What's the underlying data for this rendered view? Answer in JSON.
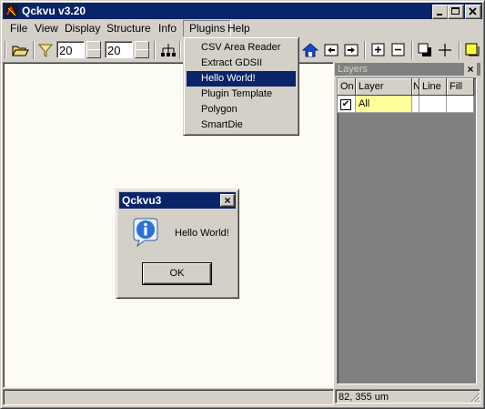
{
  "window": {
    "title": "Qckvu v3.20"
  },
  "menubar": [
    "File",
    "View",
    "Display",
    "Structure",
    "Info",
    "Plugins",
    "Help"
  ],
  "toolbar": {
    "spin1_value": "20",
    "spin2_value": "20"
  },
  "plugins_menu": {
    "items": [
      "CSV Area Reader",
      "Extract GDSII",
      "Hello World!",
      "Plugin Template",
      "Polygon",
      "SmartDie"
    ],
    "selected": "Hello World!"
  },
  "layers": {
    "title": "Layers",
    "close_label": "×",
    "columns": [
      "On",
      "Layer",
      "N",
      "Line",
      "Fill"
    ],
    "rows": [
      {
        "on": "✔",
        "layer": "All"
      }
    ]
  },
  "dialog": {
    "title": "Qckvu3",
    "message": "Hello World!",
    "ok_label": "OK",
    "close_label": "×"
  },
  "status": {
    "coords": "82, 355 um"
  },
  "colors": {
    "titlebar": "#0a246a",
    "canvas": "#fcfcf4",
    "layer_highlight": "#ffff99"
  }
}
